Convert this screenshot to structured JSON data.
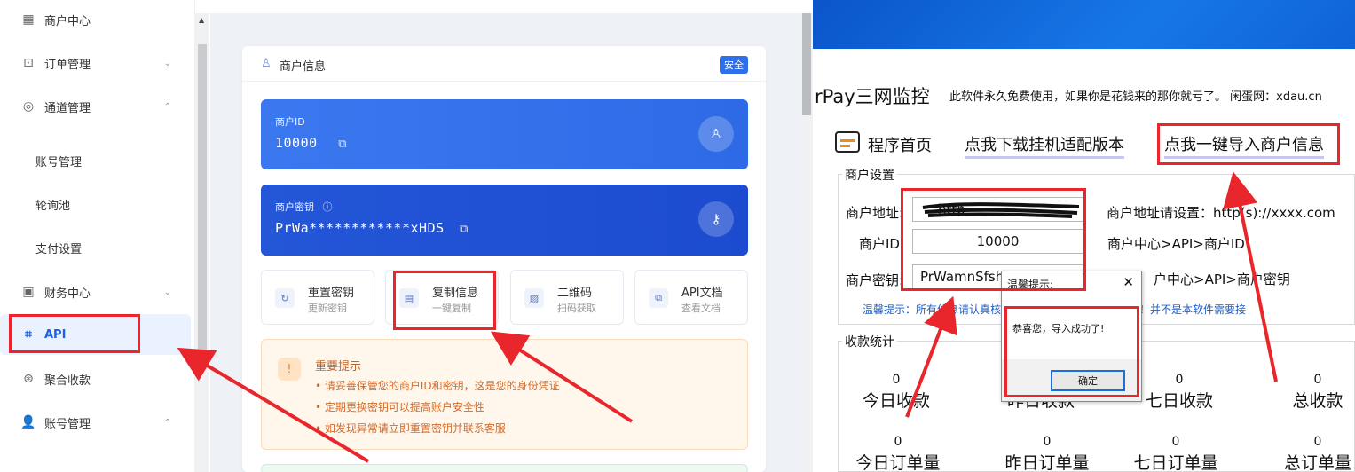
{
  "sidebar": {
    "items": [
      {
        "label": "商户中心",
        "icon": "grid-icon",
        "chevron": ""
      },
      {
        "label": "订单管理",
        "icon": "bag-icon",
        "chevron": "⌄"
      },
      {
        "label": "通道管理",
        "icon": "channel-icon",
        "chevron": "⌃"
      },
      {
        "label": "财务中心",
        "icon": "finance-icon",
        "chevron": "⌄"
      },
      {
        "label": "API",
        "icon": "chip-icon",
        "chevron": ""
      },
      {
        "label": "聚合收款",
        "icon": "aggregate-icon",
        "chevron": ""
      },
      {
        "label": "账号管理",
        "icon": "user-icon",
        "chevron": "⌃"
      }
    ],
    "sub_items": [
      "账号管理",
      "轮询池",
      "支付设置"
    ]
  },
  "merchant_card": {
    "title": "商户信息",
    "badge": "安全",
    "id_label": "商户ID",
    "id_value": "10000",
    "key_label": "商户密钥",
    "key_value": "PrWa************xHDS"
  },
  "actions": [
    {
      "label": "重置密钥",
      "sub": "更新密钥",
      "icon": "refresh-icon"
    },
    {
      "label": "复制信息",
      "sub": "一键复制",
      "icon": "document-icon"
    },
    {
      "label": "二维码",
      "sub": "扫码获取",
      "icon": "image-icon"
    },
    {
      "label": "API文档",
      "sub": "查看文档",
      "icon": "docs-icon"
    }
  ],
  "tip": {
    "title": "重要提示",
    "lines": [
      "• 请妥善保管您的商户ID和密钥，这是您的身份凭证",
      "• 定期更换密钥可以提高账户安全性",
      "• 如发现异常请立即重置密钥并联系客服"
    ]
  },
  "app": {
    "title": "rPay三网监控",
    "subtitle": "此软件永久免费使用，如果你是花钱来的那你就亏了。 闲蛋网：xdau.cn",
    "nav_home": "程序首页",
    "nav_download": "点我下载挂机适配版本",
    "nav_import": "点我一键导入商户信息",
    "settings_group": "商户设置",
    "addr_label": "商户地址:",
    "addr_value": "http",
    "id_label": "商户ID:",
    "id_value": "10000",
    "key_label": "商户密钥:",
    "key_value": "PrWamnSfsh",
    "hint_addr": "商户地址请设置：http(s)://xxxx.com",
    "hint_id": "商户中心>API>商户ID",
    "hint_key": "户中心>API>商户密钥",
    "warn": "温馨提示：所有信息请认真核对，并确认支付网站是否正版！并不是本软件需要接",
    "stats_group": "收款统计",
    "stats_row1": [
      {
        "value": "0",
        "label": "今日收款"
      },
      {
        "value": "0",
        "label": "昨日收款"
      },
      {
        "value": "0",
        "label": "七日收款"
      },
      {
        "value": "0",
        "label": "总收款"
      }
    ],
    "stats_row2": [
      {
        "value": "0",
        "label": "今日订单量"
      },
      {
        "value": "0",
        "label": "昨日订单量"
      },
      {
        "value": "0",
        "label": "七日订单量"
      },
      {
        "value": "0",
        "label": "总订单量"
      }
    ]
  },
  "dialog": {
    "title": "温馨提示:",
    "message": "恭喜您，导入成功了!",
    "ok": "确定"
  },
  "colors": {
    "primary": "#2f6fe9",
    "annotation": "#e8262b",
    "warning": "#d46b2a"
  }
}
